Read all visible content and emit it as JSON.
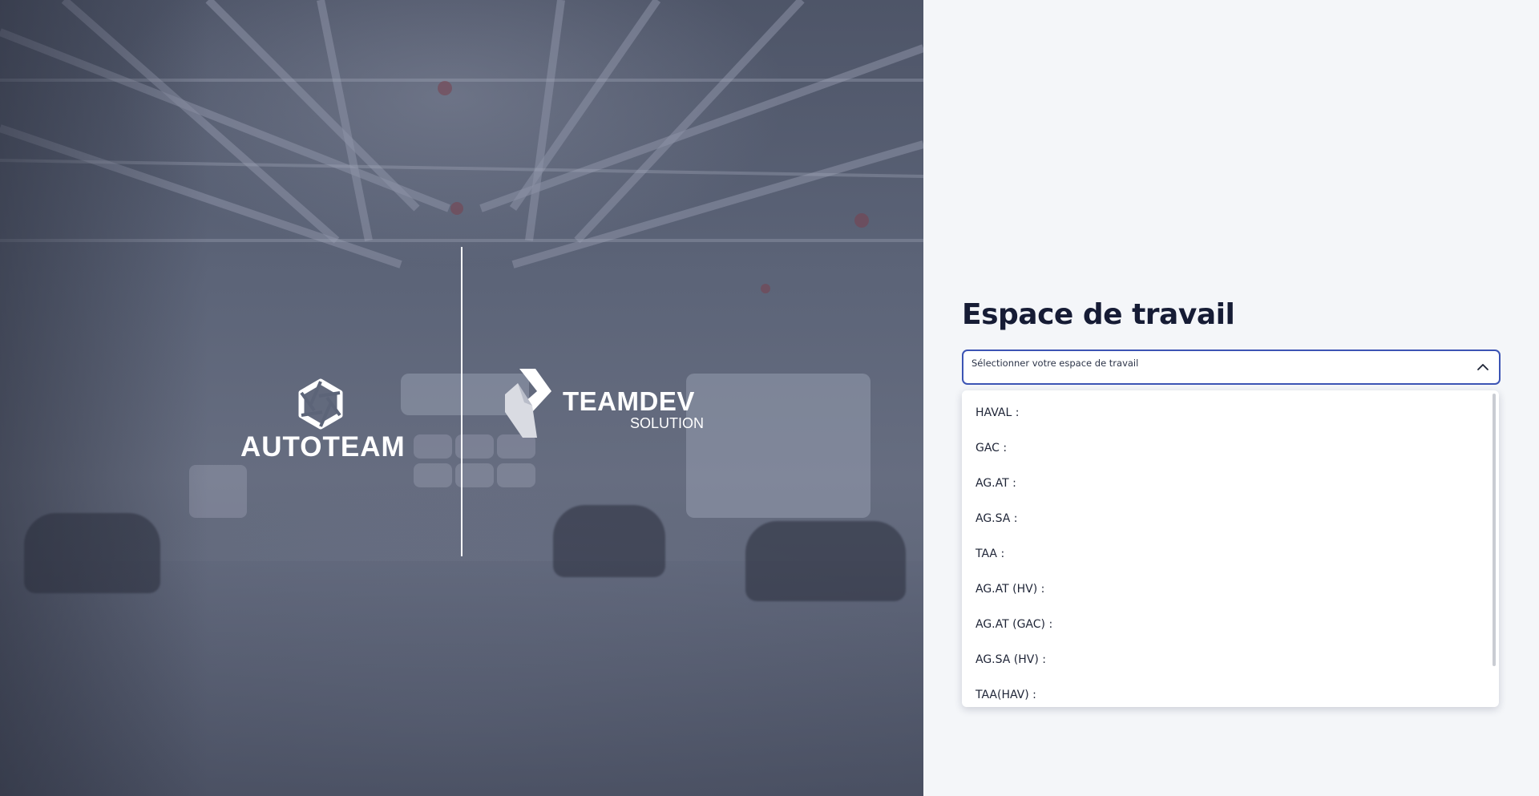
{
  "brand": {
    "autoteam_name": "AUTOTEAM",
    "teamdev_name": "TEAMDEV",
    "teamdev_subtitle": "SOLUTION"
  },
  "workspace": {
    "title": "Espace de travail",
    "select_placeholder": "Sélectionner votre espace de travail",
    "dropdown_open": true,
    "options": [
      "HAVAL :",
      "GAC :",
      "AG.AT :",
      "AG.SA :",
      "TAA :",
      "AG.AT (HV) :",
      "AG.AT (GAC) :",
      "AG.SA (HV) :",
      "TAA(HAV) :"
    ]
  },
  "colors": {
    "accent": "#3c54b4",
    "title": "#161c35",
    "panel_background": "#f4f6f9",
    "hero_tint": "#5c6478"
  }
}
